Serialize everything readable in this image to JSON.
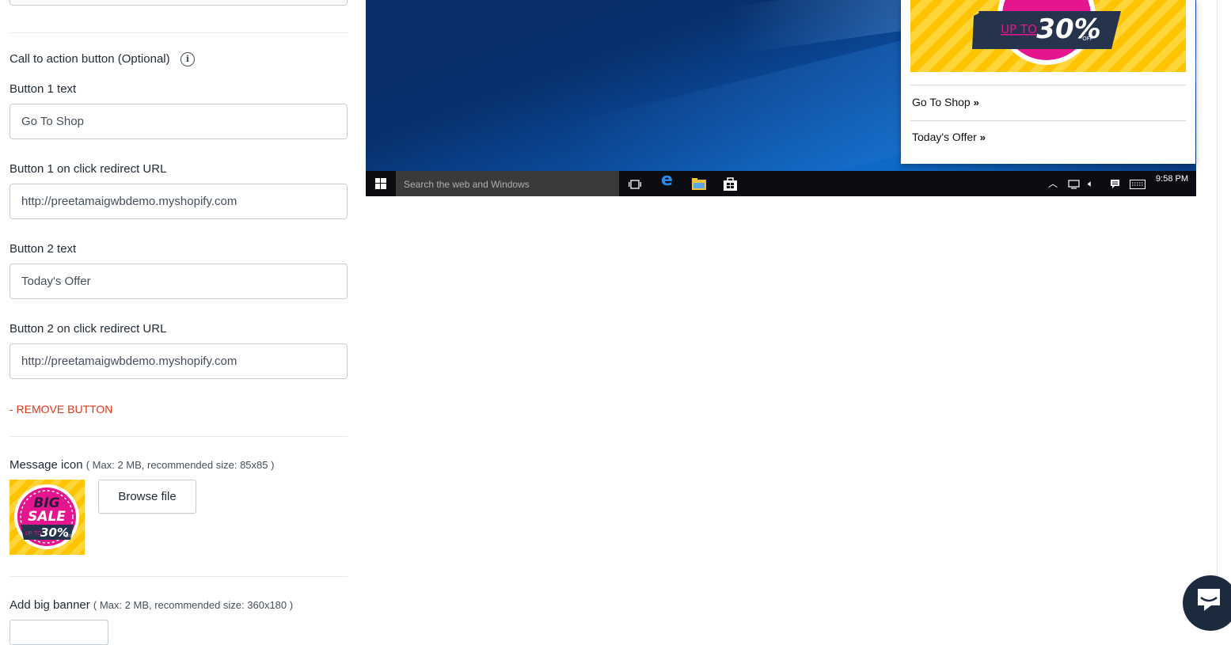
{
  "form": {
    "cta_heading": "Call to action button (Optional)",
    "button1_text_label": "Button 1 text",
    "button1_text_value": "Go To Shop",
    "button1_url_label": "Button 1 on click redirect URL",
    "button1_url_value": "http://preetamaigwbdemo.myshopify.com",
    "button2_text_label": "Button 2 text",
    "button2_text_value": "Today's Offer",
    "button2_url_label": "Button 2 on click redirect URL",
    "button2_url_value": "http://preetamaigwbdemo.myshopify.com",
    "remove_button_label": "- REMOVE BUTTON",
    "message_icon_label": "Message icon",
    "message_icon_note": "( Max: 2 MB, recommended size: 85x85 )",
    "browse_file_label": "Browse file",
    "big_banner_label": "Add big banner",
    "big_banner_note": "( Max: 2 MB, recommended size: 360x180 )"
  },
  "thumb": {
    "line1": "BIG",
    "line2": "SALE",
    "upto": "UP TO",
    "pct": "30%",
    "off": "OFF"
  },
  "preview": {
    "banner_upto": "UP TO",
    "banner_pct": "30%",
    "banner_off": "OFF",
    "button1": "Go To Shop",
    "button2": "Today's Offer",
    "taskbar_search": "Search the web and Windows",
    "taskbar_time": "9:58 PM"
  },
  "icons": {
    "info": "info-icon",
    "chevrons": "double-chevron-right-icon",
    "chat": "chat-bubble-icon"
  },
  "colors": {
    "remove": "#de3618",
    "banner_yellow": "#ffc400",
    "badge_pink": "#e5168d",
    "badge_navy": "#26334d"
  }
}
